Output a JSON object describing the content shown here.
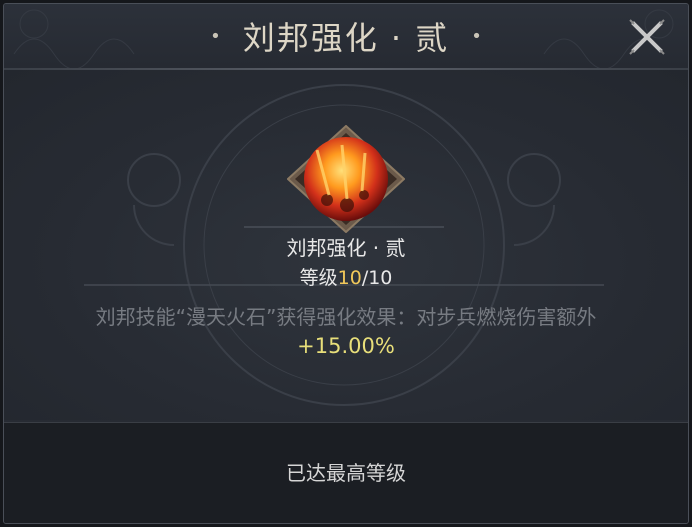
{
  "dialog": {
    "title": "刘邦强化 · 贰",
    "title_dot": "•",
    "close_icon": "close-x-icon"
  },
  "item": {
    "name": "刘邦强化 · 贰",
    "icon": "meteor-fire-icon",
    "level_label": "等级",
    "level_current": "10",
    "level_sep_max": "/10",
    "description": "刘邦技能“漫天火石”获得强化效果：对步兵燃烧伤害额外",
    "bonus": "+15.00%"
  },
  "footer": {
    "status": "已达最高等级"
  },
  "colors": {
    "accent_gold": "#f1c85a",
    "bonus_yellow": "#e8df7a",
    "panel": "#272b33"
  }
}
